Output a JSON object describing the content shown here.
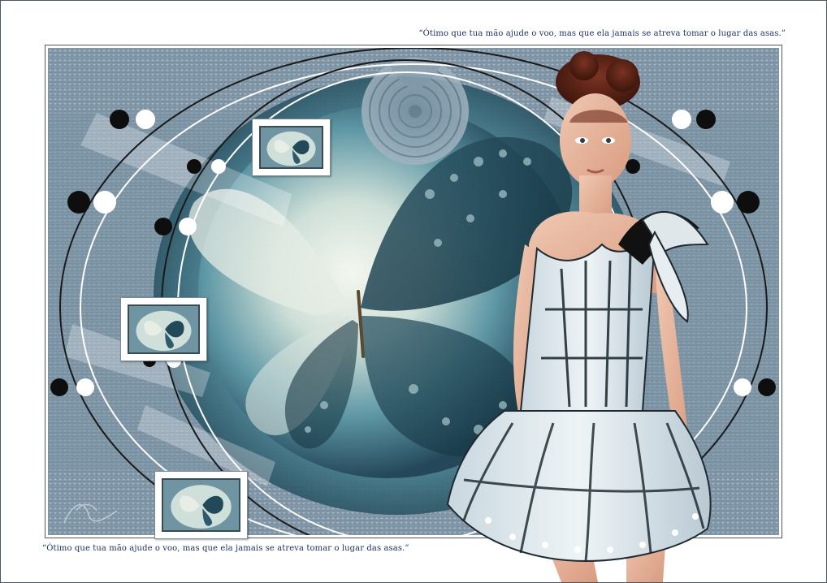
{
  "quote": {
    "top": "“Ótimo que tua mão ajude o voo, mas que ela jamais se atreva tomar o lugar das asas.”",
    "bottom": "“Ótimo que tua mão ajude o voo, mas que ela jamais se atreva tomar o lugar das asas.”"
  },
  "palette": {
    "background": "#8fa3b3",
    "teal": "#4f8a9a",
    "dark": "#1d2d38",
    "dress_light": "#dfe9ee",
    "hair": "#5a2416",
    "skin": "#e8b8a0"
  },
  "thumbnails": [
    {
      "icon": "butterfly-thumbnail"
    },
    {
      "icon": "butterfly-thumbnail"
    },
    {
      "icon": "butterfly-thumbnail"
    }
  ]
}
